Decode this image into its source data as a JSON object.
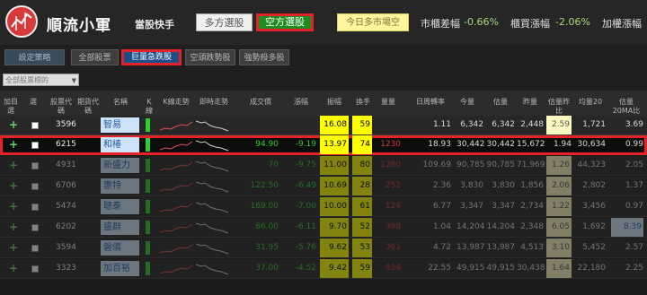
{
  "app": {
    "name": "順流小軍",
    "subtitle": "當股快手",
    "buttons": {
      "long": "多方選股",
      "short": "空方選股",
      "todays": "今日多市場空"
    },
    "stats": [
      {
        "label": "市櫃差幅",
        "value": "-0.66%"
      },
      {
        "label": "櫃買漲幅",
        "value": "-2.06%"
      },
      {
        "label": "加權漲幅",
        "value": ""
      }
    ]
  },
  "tabs": {
    "settings": "設定策略",
    "items": [
      "全部股票",
      "巨量急跌股",
      "空頭跌勢股",
      "強勢殺多股"
    ],
    "active_index": 1
  },
  "filter": {
    "value": "全部股票標的"
  },
  "columns": [
    "加目選",
    "選",
    "股票代碼",
    "期貨代碼",
    "名稱",
    "K線",
    "K線走勢",
    "即時走勢",
    "成交價",
    "漲幅",
    "振幅",
    "換手",
    "量量",
    "日周轉率",
    "今量",
    "估量",
    "昨量",
    "估量昨比",
    "均量20",
    "估量20MA比"
  ],
  "rows": [
    {
      "code": "3596",
      "name": "智易",
      "price": "",
      "chg": "",
      "amp": "16.08",
      "turn": "59",
      "vol": "",
      "rate": "1.11",
      "today": "6,342",
      "est": "6,342",
      "yest": "2,448",
      "ratio": "2.59",
      "avg20": "1,721",
      "ma_ratio": "3.69"
    },
    {
      "code": "6215",
      "name": "和椿",
      "price": "94.90",
      "chg": "-9.19",
      "amp": "13.97",
      "turn": "74",
      "vol": "1230",
      "rate": "18.93",
      "today": "30,442",
      "est": "30,442",
      "yest": "15,672",
      "ratio": "1.94",
      "avg20": "30,634",
      "ma_ratio": "0.99"
    },
    {
      "code": "4931",
      "name": "新盛力",
      "price": "70",
      "chg": "-9.75",
      "amp": "11.00",
      "turn": "80",
      "vol": "1280",
      "rate": "109.69",
      "today": "90,785",
      "est": "90,785",
      "yest": "71,969",
      "ratio": "1.26",
      "avg20": "44,323",
      "ma_ratio": "2.05"
    },
    {
      "code": "6706",
      "name": "惠特",
      "price": "122.50",
      "chg": "-6.49",
      "amp": "10.69",
      "turn": "28",
      "vol": "252",
      "rate": "2.36",
      "today": "3,830",
      "est": "3,830",
      "yest": "1,856",
      "ratio": "2.06",
      "avg20": "2,802",
      "ma_ratio": "1.37"
    },
    {
      "code": "5474",
      "name": "聰泰",
      "price": "169.00",
      "chg": "-7.00",
      "amp": "10.00",
      "turn": "61",
      "vol": "124",
      "rate": "6.77",
      "today": "3,347",
      "est": "3,347",
      "yest": "2,734",
      "ratio": "1.22",
      "avg20": "3,456",
      "ma_ratio": "0.97"
    },
    {
      "code": "6202",
      "name": "盛群",
      "price": "86.00",
      "chg": "-6.11",
      "amp": "9.70",
      "turn": "52",
      "vol": "398",
      "rate": "1.04",
      "today": "14,204",
      "est": "14,204",
      "yest": "2,348",
      "ratio": "6.05",
      "avg20": "1,692",
      "ma_ratio": "8.39"
    },
    {
      "code": "3594",
      "name": "磐儀",
      "price": "31.95",
      "chg": "-5.76",
      "amp": "9.62",
      "turn": "53",
      "vol": "361",
      "rate": "4.72",
      "today": "13,987",
      "est": "13,987",
      "yest": "4,513",
      "ratio": "3.10",
      "avg20": "5,452",
      "ma_ratio": "2.57"
    },
    {
      "code": "3323",
      "name": "加百裕",
      "price": "37.00",
      "chg": "-4.52",
      "amp": "9.42",
      "turn": "59",
      "vol": "634",
      "rate": "22.55",
      "today": "49,915",
      "est": "49,915",
      "yest": "30,438",
      "ratio": "1.64",
      "avg20": "22,180",
      "ma_ratio": "2.25"
    }
  ],
  "colors": {
    "accent_red": "#e5222a",
    "down_green": "#2ecc2e",
    "highlight_yellow": "#ffff00"
  }
}
